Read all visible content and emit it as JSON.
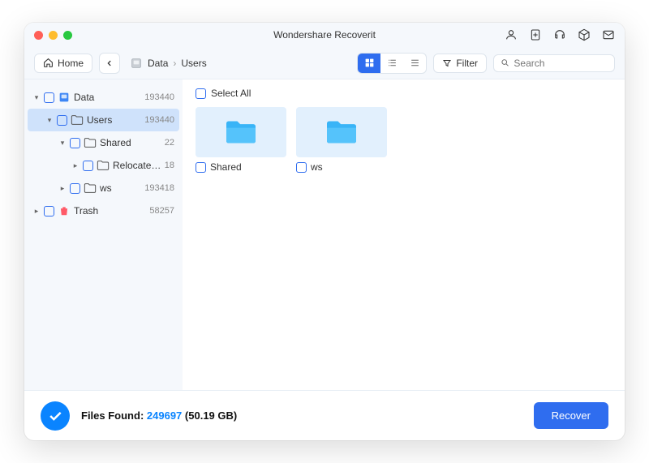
{
  "title": "Wondershare Recoverit",
  "toolbar": {
    "home_label": "Home",
    "breadcrumb": [
      "Data",
      "Users"
    ],
    "filter_label": "Filter",
    "search_placeholder": "Search"
  },
  "tree": [
    {
      "indent": 0,
      "label": "Data",
      "count": "193440",
      "icon": "disk",
      "expanded": true
    },
    {
      "indent": 1,
      "label": "Users",
      "count": "193440",
      "icon": "folder",
      "expanded": true,
      "selected": true
    },
    {
      "indent": 2,
      "label": "Shared",
      "count": "22",
      "icon": "folder",
      "expanded": true
    },
    {
      "indent": 3,
      "label": "Relocated Items",
      "count": "18",
      "icon": "folder",
      "expanded": false
    },
    {
      "indent": 2,
      "label": "ws",
      "count": "193418",
      "icon": "folder",
      "expanded": false
    },
    {
      "indent": 0,
      "label": "Trash",
      "count": "58257",
      "icon": "trash",
      "expanded": false
    }
  ],
  "main": {
    "select_all_label": "Select All",
    "folders": [
      {
        "name": "Shared"
      },
      {
        "name": "ws"
      }
    ]
  },
  "footer": {
    "files_found_label": "Files Found:",
    "count": "249697",
    "size": "(50.19 GB)",
    "recover_label": "Recover"
  }
}
